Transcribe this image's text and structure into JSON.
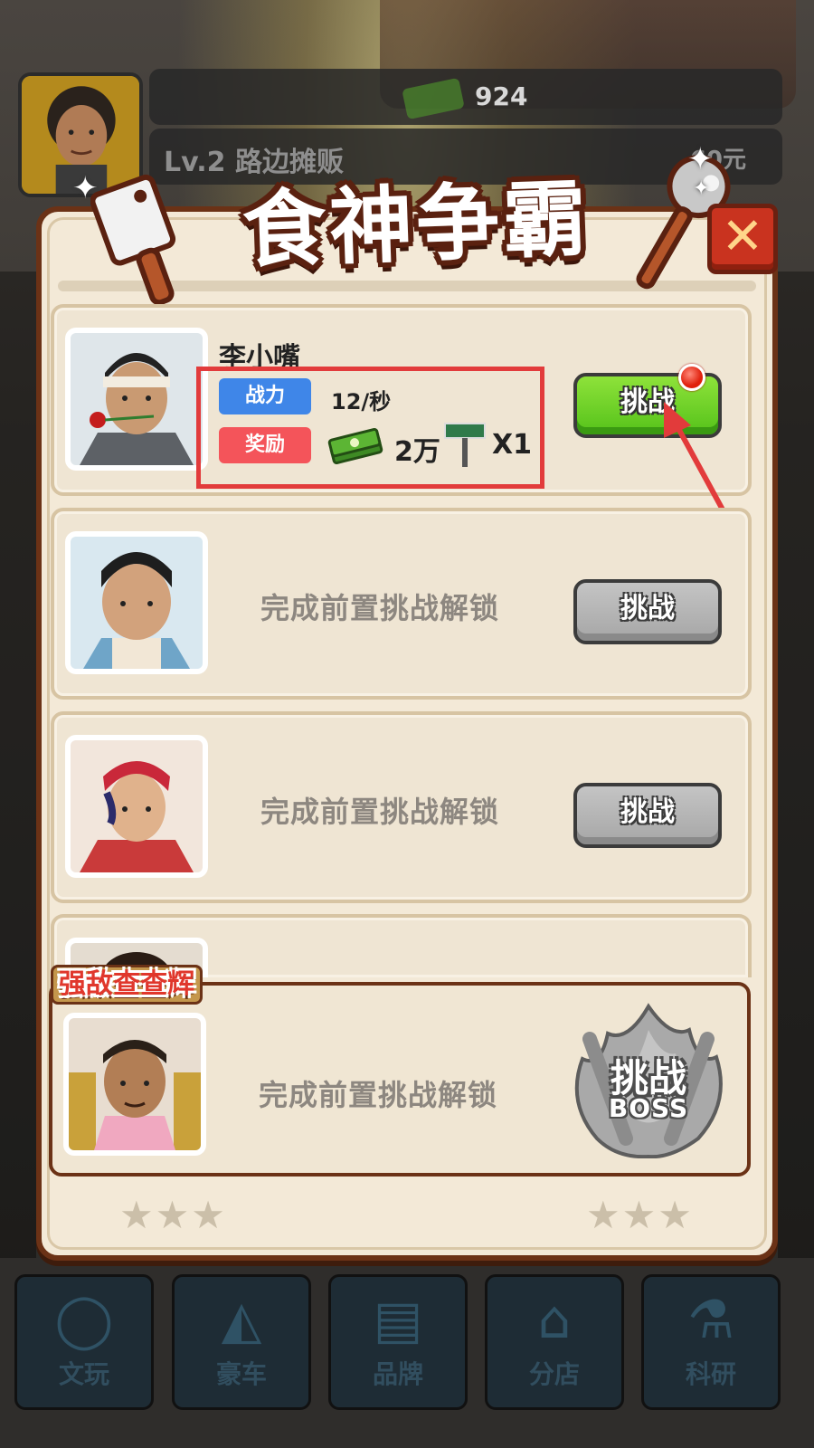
{
  "hud": {
    "money": "924",
    "level": "Lv.2 路边摊贩",
    "price": "60元"
  },
  "dialog": {
    "title": "食神争霸",
    "close_symbol": "✕"
  },
  "challengers": [
    {
      "name": "李小嘴",
      "power_label": "战力",
      "power_value": "12/秒",
      "reward_label": "奖励",
      "reward_amount": "2万",
      "reward_item_count": "X1",
      "button_label": "挑战",
      "status": "available"
    },
    {
      "locked_text": "完成前置挑战解锁",
      "button_label": "挑战",
      "status": "locked"
    },
    {
      "locked_text": "完成前置挑战解锁",
      "button_label": "挑战",
      "status": "locked"
    }
  ],
  "boss": {
    "label": "强敌查查辉",
    "locked_text": "完成前置挑战解锁",
    "button_main": "挑战",
    "button_sub": "BOSS"
  },
  "stars": {
    "left": "★★★",
    "right": "★★★"
  },
  "bottom_nav": [
    {
      "label": "文玩",
      "icon": "beads-icon"
    },
    {
      "label": "豪车",
      "icon": "car-icon"
    },
    {
      "label": "品牌",
      "icon": "brand-icon"
    },
    {
      "label": "分店",
      "icon": "branch-store-icon"
    },
    {
      "label": "科研",
      "icon": "flask-icon"
    }
  ],
  "colors": {
    "power_tag": "#3f86e8",
    "reward_tag": "#f4545a",
    "active_button": "#55c21a",
    "disabled_button": "#a6a6a6",
    "highlight": "#e23b3b",
    "dialog_border": "#6b3216"
  }
}
